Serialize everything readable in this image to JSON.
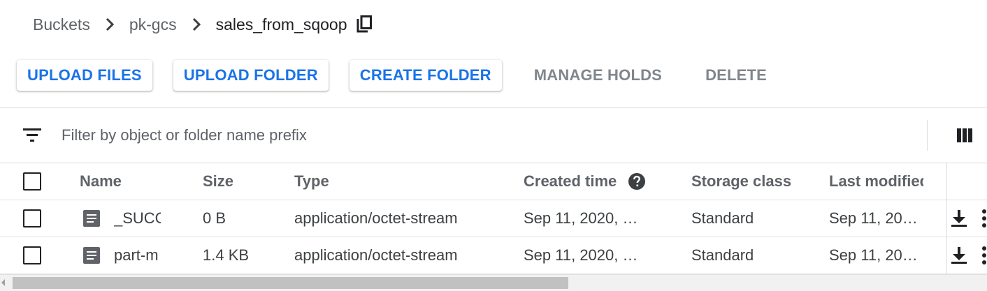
{
  "breadcrumb": {
    "items": [
      "Buckets",
      "pk-gcs"
    ],
    "current": "sales_from_sqoop"
  },
  "toolbar": {
    "upload_files": "UPLOAD FILES",
    "upload_folder": "UPLOAD FOLDER",
    "create_folder": "CREATE FOLDER",
    "manage_holds": "MANAGE HOLDS",
    "delete": "DELETE"
  },
  "filter": {
    "placeholder": "Filter by object or folder name prefix",
    "value": ""
  },
  "table": {
    "headers": {
      "name": "Name",
      "size": "Size",
      "type": "Type",
      "created": "Created time",
      "storage": "Storage class",
      "modified": "Last modified"
    },
    "rows": [
      {
        "name": "_SUCC",
        "size": "0 B",
        "type": "application/octet-stream",
        "created": "Sep 11, 2020, …",
        "storage": "Standard",
        "modified": "Sep 11, 20…"
      },
      {
        "name": "part-m",
        "size": "1.4 KB",
        "type": "application/octet-stream",
        "created": "Sep 11, 2020, …",
        "storage": "Standard",
        "modified": "Sep 11, 20…"
      }
    ]
  },
  "icons": {
    "breadcrumb_separator": "chevron-right-icon",
    "copy": "copy-icon",
    "filter": "filter-list-icon",
    "columns": "view-columns-icon",
    "help": "help-icon",
    "file": "file-icon",
    "download": "download-icon",
    "more": "more-vert-icon"
  },
  "colors": {
    "accent": "#1a73e8",
    "disabled": "#80868b",
    "text": "#202124",
    "secondary_text": "#5f6368"
  }
}
